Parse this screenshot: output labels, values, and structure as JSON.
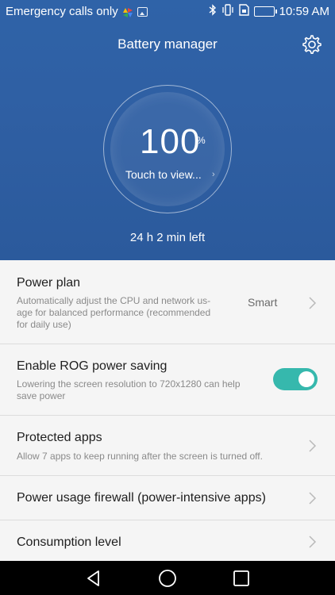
{
  "status_bar": {
    "carrier": "Emergency calls only",
    "time": "10:59 AM",
    "icons": [
      "pinwheel-icon",
      "image-icon",
      "bluetooth-icon",
      "vibrate-icon",
      "sim-icon",
      "battery-icon"
    ]
  },
  "header": {
    "title": "Battery manager",
    "settings_icon": "gear-icon"
  },
  "gauge": {
    "percent": "100",
    "percent_sign": "%",
    "touch_label": "Touch to view...",
    "time_left": "24 h 2 min left"
  },
  "settings": {
    "power_plan": {
      "title": "Power plan",
      "desc_line1": "Automatically adjust the CPU and network us-",
      "desc_line2": "age for balanced performance (recommended",
      "desc_line3": "for daily use)",
      "value": "Smart"
    },
    "rog": {
      "title": "Enable ROG power saving",
      "desc_line1": "Lowering the screen resolution to 720x1280 can help",
      "desc_line2": "save power",
      "enabled": true
    },
    "protected_apps": {
      "title": "Protected apps",
      "desc": "Allow 7 apps to keep running after the screen is turned off."
    },
    "firewall": {
      "title": "Power usage firewall (power-intensive apps)"
    },
    "consumption": {
      "title": "Consumption level"
    }
  },
  "navbar": {
    "icons": [
      "back-icon",
      "home-icon",
      "recents-icon"
    ]
  },
  "colors": {
    "header_blue": "#2f5fa3",
    "toggle_accent": "#36b8ad"
  }
}
